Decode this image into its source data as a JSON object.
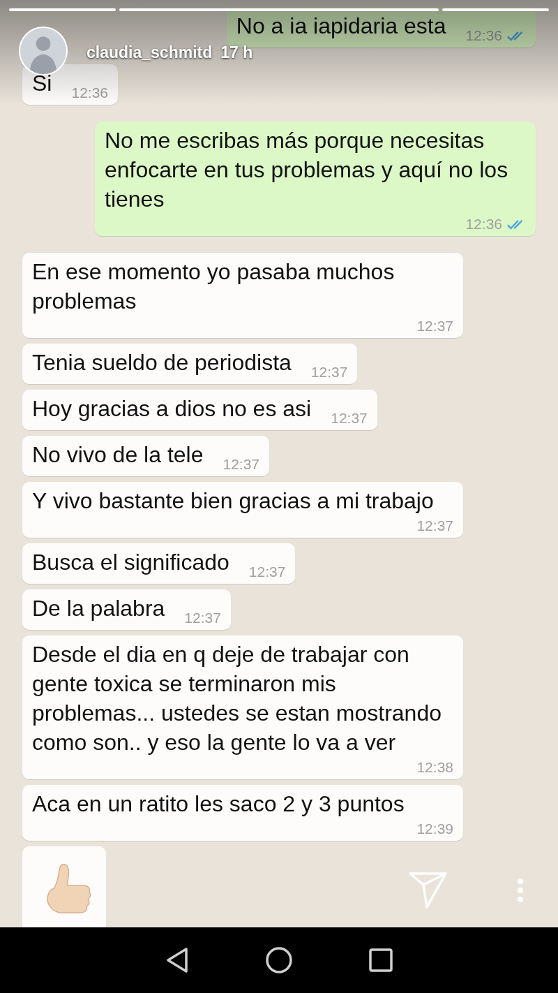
{
  "story": {
    "progress": [
      {
        "level": 1
      },
      {
        "level": 1
      },
      {
        "level": 1
      }
    ],
    "username": "claudia_schmitd",
    "age": "17 h"
  },
  "messages": [
    {
      "kind": "text",
      "outgoing": true,
      "text": "No a ia iapidaria esta",
      "time": "12:36",
      "read": true
    },
    {
      "kind": "text",
      "outgoing": false,
      "text": "Si",
      "time": "12:36"
    },
    {
      "kind": "text",
      "outgoing": true,
      "text": "No me escribas más porque necesitas enfocarte en tus problemas y aquí no los tienes",
      "time": "12:36",
      "read": true
    },
    {
      "kind": "text",
      "outgoing": false,
      "text": "En ese momento yo pasaba muchos problemas",
      "time": "12:37"
    },
    {
      "kind": "text",
      "outgoing": false,
      "text": "Tenia sueldo de periodista",
      "time": "12:37"
    },
    {
      "kind": "text",
      "outgoing": false,
      "text": "Hoy gracias a dios no es asi",
      "time": "12:37"
    },
    {
      "kind": "text",
      "outgoing": false,
      "text": "No vivo de la tele",
      "time": "12:37"
    },
    {
      "kind": "text",
      "outgoing": false,
      "text": "Y vivo bastante bien gracias a mi trabajo",
      "time": "12:37"
    },
    {
      "kind": "text",
      "outgoing": false,
      "text": "Busca el significado",
      "time": "12:37"
    },
    {
      "kind": "text",
      "outgoing": false,
      "text": "De la palabra",
      "time": "12:37"
    },
    {
      "kind": "text",
      "outgoing": false,
      "text": "Desde el dia en q deje de trabajar con gente toxica se terminaron mis problemas... ustedes se estan mostrando como son.. y eso la gente lo va a ver",
      "time": "12:38"
    },
    {
      "kind": "text",
      "outgoing": false,
      "text": "Aca en un ratito les saco 2 y 3 puntos",
      "time": "12:39"
    },
    {
      "kind": "emoji",
      "outgoing": false
    }
  ]
}
